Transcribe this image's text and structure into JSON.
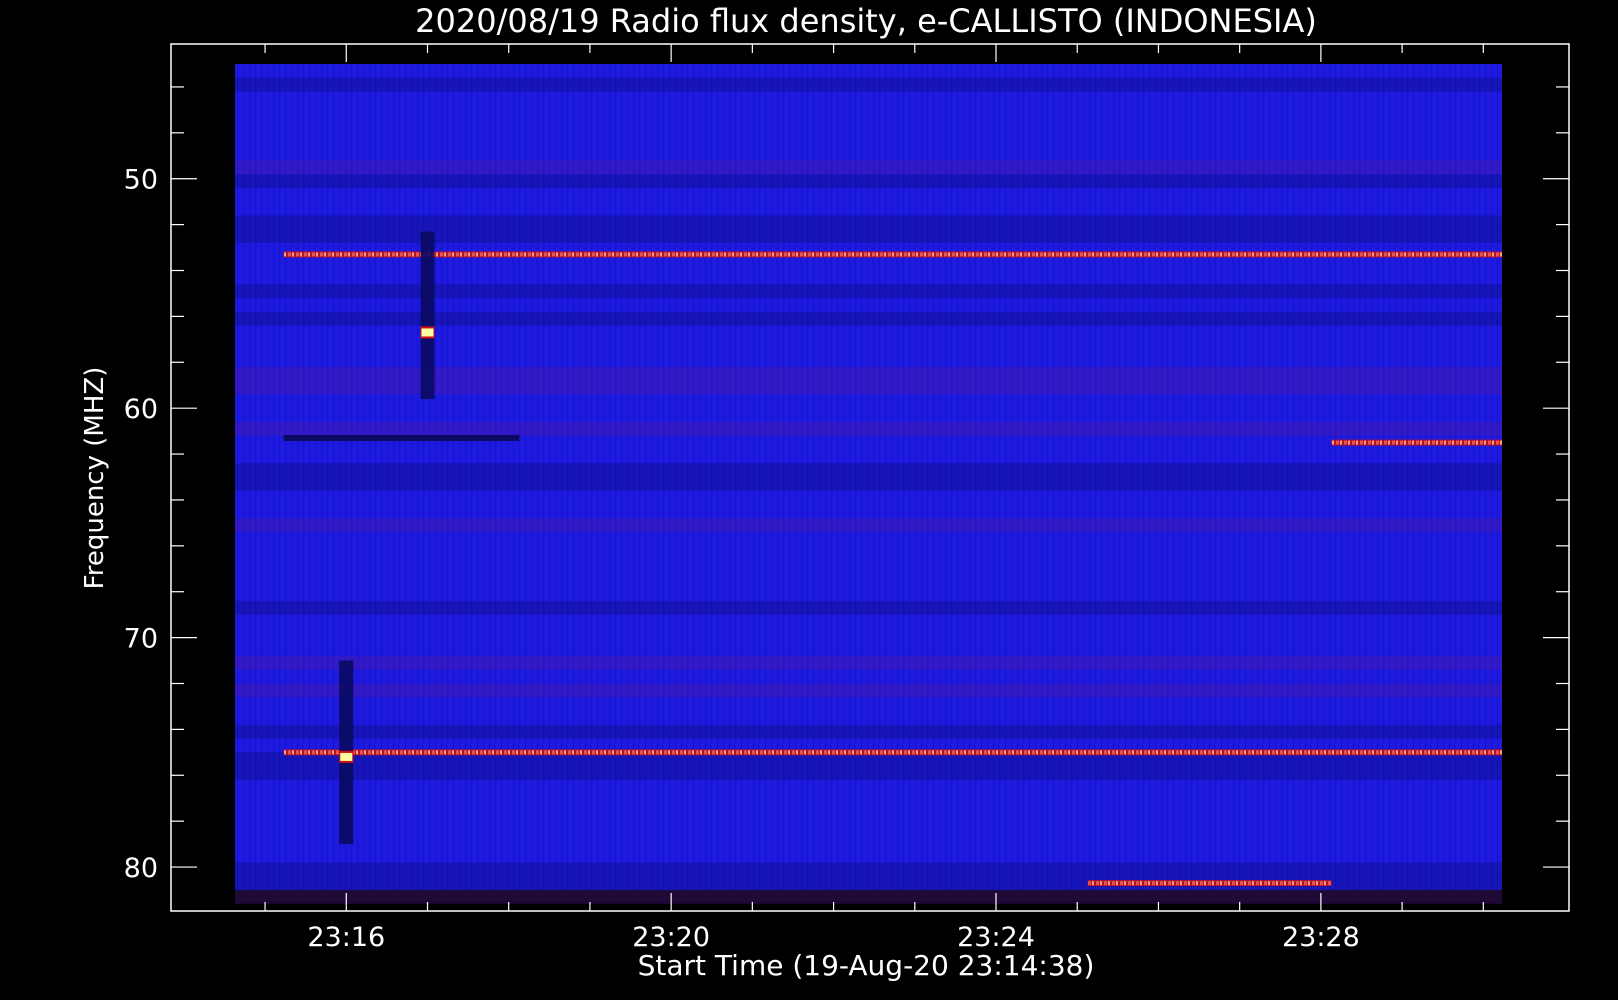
{
  "chart_data": {
    "type": "heatmap",
    "title": "2020/08/19  Radio flux density, e-CALLISTO (INDONESIA)",
    "xlabel": "Start Time (19-Aug-20 23:14:38)",
    "ylabel": "Frequency (MHZ)",
    "x_range_minutes": [
      0,
      15.6
    ],
    "y_range_mhz": [
      45,
      81
    ],
    "y_inverted": true,
    "x_ticks": [
      {
        "label": "23:16",
        "minute": 1.37
      },
      {
        "label": "23:20",
        "minute": 5.37
      },
      {
        "label": "23:24",
        "minute": 9.37
      },
      {
        "label": "23:28",
        "minute": 13.37
      }
    ],
    "y_ticks": [
      {
        "label": "50",
        "mhz": 50
      },
      {
        "label": "60",
        "mhz": 60
      },
      {
        "label": "70",
        "mhz": 70
      },
      {
        "label": "80",
        "mhz": 80
      }
    ],
    "colors": {
      "background": "#000000",
      "base": "#1a1ae6",
      "low": "#0a0a60",
      "mid": "#5a1a9a",
      "high": "#d01010",
      "peak": "#ffffa0"
    },
    "features": [
      {
        "kind": "band",
        "mhz": 53.3,
        "intensity": "high",
        "t0": 0.6,
        "t1": 15.6
      },
      {
        "kind": "band",
        "mhz": 61.3,
        "intensity": "low",
        "t0": 0.6,
        "t1": 3.5
      },
      {
        "kind": "band",
        "mhz": 61.5,
        "intensity": "high",
        "t0": 13.5,
        "t1": 15.6
      },
      {
        "kind": "band",
        "mhz": 75.0,
        "intensity": "high",
        "t0": 0.6,
        "t1": 15.6
      },
      {
        "kind": "band",
        "mhz": 80.7,
        "intensity": "high",
        "t0": 10.5,
        "t1": 13.5
      },
      {
        "kind": "burst",
        "minute": 1.37,
        "mhz_from": 71.0,
        "mhz_to": 79.0,
        "peak_mhz": 75.2
      },
      {
        "kind": "burst",
        "minute": 2.37,
        "mhz_from": 52.3,
        "mhz_to": 59.6,
        "peak_mhz": 56.7
      }
    ]
  }
}
